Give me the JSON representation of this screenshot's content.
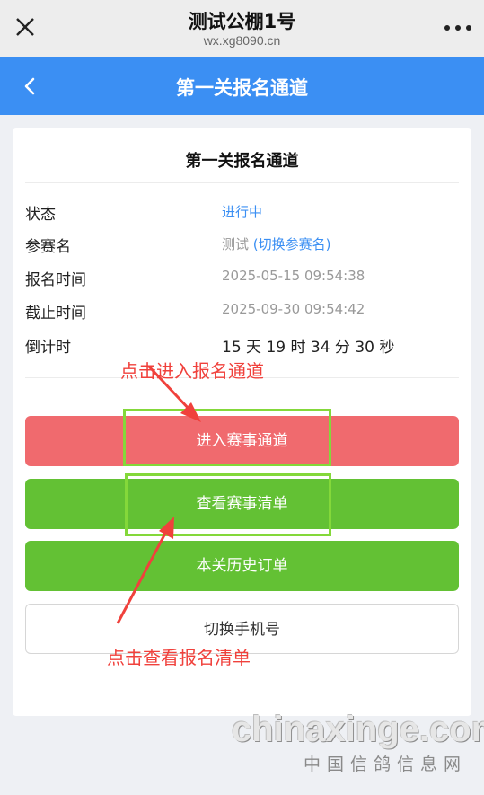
{
  "browser": {
    "title": "测试公棚1号",
    "url": "wx.xg8090.cn"
  },
  "navbar": {
    "title": "第一关报名通道"
  },
  "card": {
    "title": "第一关报名通道",
    "rows": [
      {
        "label": "状态",
        "value": "进行中"
      },
      {
        "label": "参赛名",
        "value": "测试",
        "link": "(切换参赛名)"
      },
      {
        "label": "报名时间",
        "value": "2025-05-15 09:54:38"
      },
      {
        "label": "截止时间",
        "value": "2025-09-30 09:54:42"
      },
      {
        "label": "倒计时",
        "value": "15 天 19 时 34 分 30 秒"
      }
    ]
  },
  "buttons": {
    "enter": "进入赛事通道",
    "view_list": "查看赛事清单",
    "history": "本关历史订单",
    "switch_phone": "切换手机号"
  },
  "annotations": {
    "top": "点击进入报名通道",
    "bottom": "点击查看报名清单"
  },
  "watermark": {
    "main": "chinaxinge.com",
    "sub": "中国信鸽信息网"
  },
  "colors": {
    "accent_blue": "#3b8ff3",
    "button_red": "#f06a6e",
    "button_green": "#63c134",
    "annotation_red": "#f0413c",
    "annotation_box": "#84d83a"
  }
}
